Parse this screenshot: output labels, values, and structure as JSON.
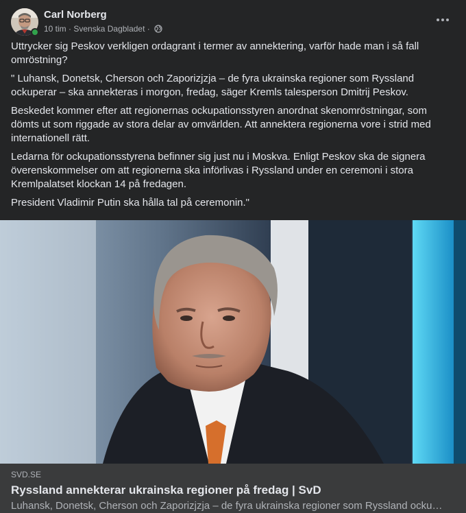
{
  "post": {
    "author": "Carl Norberg",
    "time": "10 tim",
    "source": "Svenska Dagbladet",
    "separator": "·",
    "privacy_icon": "globe-icon",
    "more_icon": "more-options-icon",
    "paragraphs": [
      "Uttrycker sig Peskov verkligen ordagrant i termer av annektering, varför hade man i så fall omröstning?",
      "\" Luhansk, Donetsk, Cherson och Zaporizjzja – de fyra ukrainska regioner som Ryssland ockuperar – ska annekteras i morgon, fredag, säger Kremls talesperson Dmitrij Peskov.",
      "Beskedet kommer efter att regionernas ockupationsstyren anordnat skenomröstningar, som dömts ut som riggade av stora delar av omvärlden. Att annektera regionerna vore i strid med internationell rätt.",
      "Ledarna för ockupationsstyrena befinner sig just nu i Moskva. Enligt Peskov ska de signera överenskommelser om att regionerna ska införlivas i Ryssland under en ceremoni i stora Kremlpalatset klockan 14 på fredagen.",
      "President Vladimir Putin ska hålla tal på ceremonin.\""
    ]
  },
  "link": {
    "domain": "SVD.SE",
    "title": "Ryssland annekterar ukrainska regioner på fredag | SvD",
    "description": "Luhansk, Donetsk, Cherson och Zaporizjzja – de fyra ukrainska regioner som Ryssland ockuperar – ska annekteras i morgon, fredag, säger Kremls talesperson Dmitrij Peskov."
  },
  "colors": {
    "background": "#242526",
    "link_box": "#3a3b3c",
    "text_primary": "#e4e6eb",
    "text_secondary": "#b0b3b8",
    "online": "#31a24c"
  }
}
